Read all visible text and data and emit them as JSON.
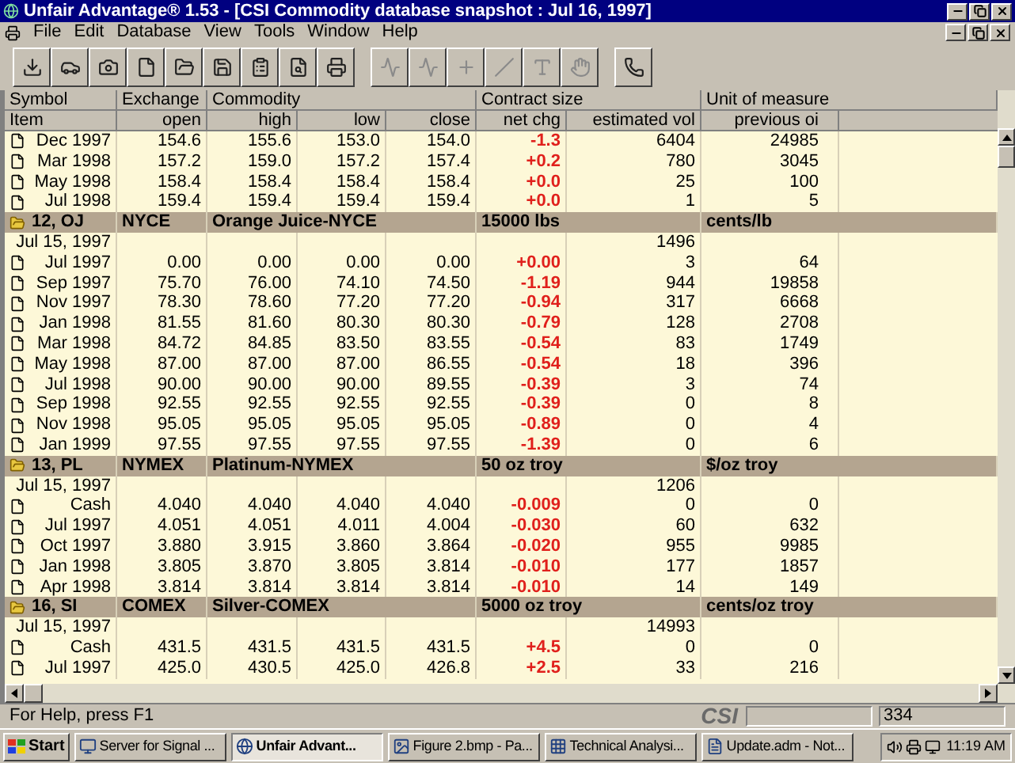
{
  "window": {
    "title": "Unfair Advantage® 1.53 - [CSI Commodity database snapshot : Jul 16, 1997]"
  },
  "menu": [
    "File",
    "Edit",
    "Database",
    "View",
    "Tools",
    "Window",
    "Help"
  ],
  "toolbar": [
    {
      "disabled": false
    },
    {
      "disabled": false
    },
    {
      "disabled": false
    },
    {
      "disabled": false
    },
    {
      "disabled": false
    },
    {
      "disabled": false
    },
    {
      "disabled": false
    },
    {
      "disabled": false
    },
    {
      "disabled": false
    },
    {
      "disabled": true
    },
    {
      "disabled": true
    },
    {
      "disabled": true
    },
    {
      "disabled": true
    },
    {
      "disabled": true
    },
    {
      "disabled": true
    },
    {
      "disabled": false
    }
  ],
  "table": {
    "header_top": [
      "Symbol",
      "Exchange",
      "Commodity",
      "Contract size",
      "Unit of measure"
    ],
    "header": [
      "Item",
      "open",
      "high",
      "low",
      "close",
      "net chg",
      "estimated vol",
      "previous oi"
    ],
    "rows": [
      {
        "kind": "contract",
        "item": "Dec 1997",
        "values": [
          "154.6",
          "155.6",
          "153.0",
          "154.0",
          "-1.3",
          "6404",
          "24985"
        ]
      },
      {
        "kind": "contract",
        "item": "Mar 1998",
        "values": [
          "157.2",
          "159.0",
          "157.2",
          "157.4",
          "+0.2",
          "780",
          "3045"
        ]
      },
      {
        "kind": "contract",
        "item": "May 1998",
        "values": [
          "158.4",
          "158.4",
          "158.4",
          "158.4",
          "+0.0",
          "25",
          "100"
        ]
      },
      {
        "kind": "contract",
        "item": "Jul 1998",
        "values": [
          "159.4",
          "159.4",
          "159.4",
          "159.4",
          "+0.0",
          "1",
          "5"
        ]
      },
      {
        "kind": "group",
        "symbol": "12, OJ",
        "exchange": "NYCE",
        "commodity": "Orange Juice-NYCE",
        "contract_size": "15000 lbs",
        "unit": "cents/lb"
      },
      {
        "kind": "date",
        "item": "Jul 15, 1997",
        "vol": "1496"
      },
      {
        "kind": "contract",
        "item": "Jul 1997",
        "values": [
          "0.00",
          "0.00",
          "0.00",
          "0.00",
          "+0.00",
          "3",
          "64"
        ]
      },
      {
        "kind": "contract",
        "item": "Sep 1997",
        "values": [
          "75.70",
          "76.00",
          "74.10",
          "74.50",
          "-1.19",
          "944",
          "19858"
        ]
      },
      {
        "kind": "contract",
        "item": "Nov 1997",
        "values": [
          "78.30",
          "78.60",
          "77.20",
          "77.20",
          "-0.94",
          "317",
          "6668"
        ]
      },
      {
        "kind": "contract",
        "item": "Jan 1998",
        "values": [
          "81.55",
          "81.60",
          "80.30",
          "80.30",
          "-0.79",
          "128",
          "2708"
        ]
      },
      {
        "kind": "contract",
        "item": "Mar 1998",
        "values": [
          "84.72",
          "84.85",
          "83.50",
          "83.55",
          "-0.54",
          "83",
          "1749"
        ]
      },
      {
        "kind": "contract",
        "item": "May 1998",
        "values": [
          "87.00",
          "87.00",
          "87.00",
          "86.55",
          "-0.54",
          "18",
          "396"
        ]
      },
      {
        "kind": "contract",
        "item": "Jul 1998",
        "values": [
          "90.00",
          "90.00",
          "90.00",
          "89.55",
          "-0.39",
          "3",
          "74"
        ]
      },
      {
        "kind": "contract",
        "item": "Sep 1998",
        "values": [
          "92.55",
          "92.55",
          "92.55",
          "92.55",
          "-0.39",
          "0",
          "8"
        ]
      },
      {
        "kind": "contract",
        "item": "Nov 1998",
        "values": [
          "95.05",
          "95.05",
          "95.05",
          "95.05",
          "-0.89",
          "0",
          "4"
        ]
      },
      {
        "kind": "contract",
        "item": "Jan 1999",
        "values": [
          "97.55",
          "97.55",
          "97.55",
          "97.55",
          "-1.39",
          "0",
          "6"
        ]
      },
      {
        "kind": "group",
        "symbol": "13, PL",
        "exchange": "NYMEX",
        "commodity": "Platinum-NYMEX",
        "contract_size": "50 oz troy",
        "unit": "$/oz troy"
      },
      {
        "kind": "date",
        "item": "Jul 15, 1997",
        "vol": "1206"
      },
      {
        "kind": "contract",
        "item": "Cash",
        "values": [
          "4.040",
          "4.040",
          "4.040",
          "4.040",
          "-0.009",
          "0",
          "0"
        ]
      },
      {
        "kind": "contract",
        "item": "Jul 1997",
        "values": [
          "4.051",
          "4.051",
          "4.011",
          "4.004",
          "-0.030",
          "60",
          "632"
        ]
      },
      {
        "kind": "contract",
        "item": "Oct 1997",
        "values": [
          "3.880",
          "3.915",
          "3.860",
          "3.864",
          "-0.020",
          "955",
          "9985"
        ]
      },
      {
        "kind": "contract",
        "item": "Jan 1998",
        "values": [
          "3.805",
          "3.870",
          "3.805",
          "3.814",
          "-0.010",
          "177",
          "1857"
        ]
      },
      {
        "kind": "contract",
        "item": "Apr 1998",
        "values": [
          "3.814",
          "3.814",
          "3.814",
          "3.814",
          "-0.010",
          "14",
          "149"
        ]
      },
      {
        "kind": "group",
        "symbol": "16, SI",
        "exchange": "COMEX",
        "commodity": "Silver-COMEX",
        "contract_size": "5000 oz troy",
        "unit": "cents/oz troy"
      },
      {
        "kind": "date",
        "item": "Jul 15, 1997",
        "vol": "14993"
      },
      {
        "kind": "contract",
        "item": "Cash",
        "values": [
          "431.5",
          "431.5",
          "431.5",
          "431.5",
          "+4.5",
          "0",
          "0"
        ]
      },
      {
        "kind": "contract",
        "item": "Jul 1997",
        "values": [
          "425.0",
          "430.5",
          "425.0",
          "426.8",
          "+2.5",
          "33",
          "216"
        ]
      }
    ]
  },
  "status_bar": {
    "message": "For Help, press F1",
    "logo": "CSI",
    "count": "334"
  },
  "taskbar": {
    "start": "Start",
    "tasks": [
      {
        "label": "Server for Signal ...",
        "selected": false
      },
      {
        "label": "Unfair Advant...",
        "selected": true
      },
      {
        "label": "Figure 2.bmp - Pa...",
        "selected": false
      },
      {
        "label": "Technical Analysi...",
        "selected": false
      },
      {
        "label": "Update.adm - Not...",
        "selected": false
      }
    ],
    "clock": "11:19 AM"
  }
}
